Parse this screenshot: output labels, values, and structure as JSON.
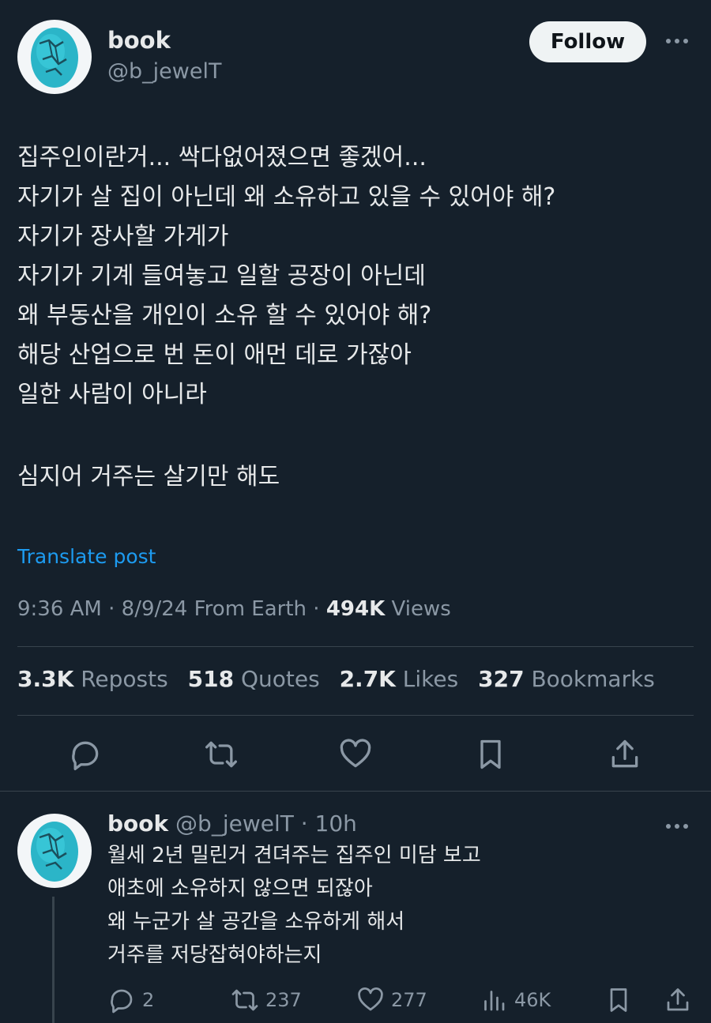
{
  "post": {
    "author_name": "book",
    "author_handle": "@b_jewelT",
    "follow_label": "Follow",
    "lines": [
      "집주인이란거... 싹다없어졌으면 좋겠어...",
      "자기가 살 집이 아닌데 왜 소유하고 있을 수 있어야 해?",
      "자기가 장사할 가게가",
      "자기가 기계 들여놓고 일할 공장이 아닌데",
      "왜 부동산을 개인이 소유 할 수 있어야 해?",
      "해당 산업으로 번 돈이 애먼 데로 가잖아",
      "일한 사람이 아니라",
      "",
      "심지어 거주는 살기만 해도"
    ],
    "translate_label": "Translate post",
    "meta_prefix": "9:36 AM · 8/9/24 From Earth · ",
    "views_count": "494K",
    "views_label": " Views",
    "stats": [
      {
        "count": "3.3K",
        "label": " Reposts"
      },
      {
        "count": "518",
        "label": " Quotes"
      },
      {
        "count": "2.7K",
        "label": " Likes"
      },
      {
        "count": "327",
        "label": " Bookmarks"
      }
    ],
    "action_icons": [
      "reply-icon",
      "repost-icon",
      "like-icon",
      "bookmark-icon",
      "share-icon"
    ]
  },
  "reply": {
    "author_name": "book",
    "author_handle": "@b_jewelT",
    "time": " · 10h",
    "lines": [
      "월세 2년 밀린거 견뎌주는 집주인 미담 보고",
      "애초에 소유하지 않으면 되잖아",
      "왜 누군가 살 공간을 소유하게 해서",
      "거주를 저당잡혀야하는지"
    ],
    "counts": {
      "replies": "2",
      "reposts": "237",
      "likes": "277",
      "views": "46K"
    }
  },
  "colors": {
    "background": "#15202b",
    "text": "#e7e9ea",
    "muted": "#8b98a5",
    "link": "#1d9bf0",
    "divider": "#38444d",
    "avatar_turquoise": "#2bb5c8"
  }
}
